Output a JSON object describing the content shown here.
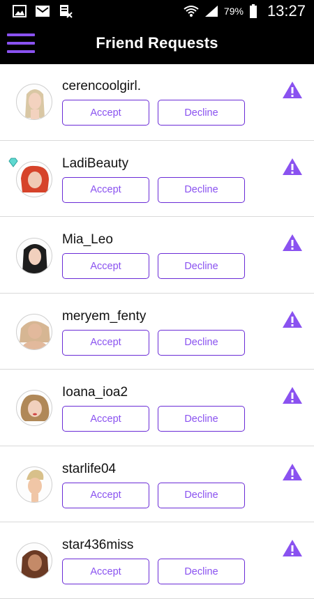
{
  "status_bar": {
    "battery_percent": "79%",
    "time": "13:27",
    "icons": [
      "gallery-icon",
      "mail-icon",
      "file-muted-icon",
      "wifi-icon",
      "signal-icon",
      "battery-icon"
    ]
  },
  "header": {
    "title": "Friend Requests",
    "menu_icon": "hamburger-menu-icon"
  },
  "accent_color": "#8a52f0",
  "requests": [
    {
      "username": "cerencoolgirl.",
      "accept_label": "Accept",
      "decline_label": "Decline"
    },
    {
      "username": "LadiBeauty",
      "accept_label": "Accept",
      "decline_label": "Decline"
    },
    {
      "username": "Mia_Leo",
      "accept_label": "Accept",
      "decline_label": "Decline"
    },
    {
      "username": "meryem_fenty",
      "accept_label": "Accept",
      "decline_label": "Decline"
    },
    {
      "username": "Ioana_ioa2",
      "accept_label": "Accept",
      "decline_label": "Decline"
    },
    {
      "username": "starlife04",
      "accept_label": "Accept",
      "decline_label": "Decline"
    },
    {
      "username": "star436miss",
      "accept_label": "Accept",
      "decline_label": "Decline"
    }
  ]
}
